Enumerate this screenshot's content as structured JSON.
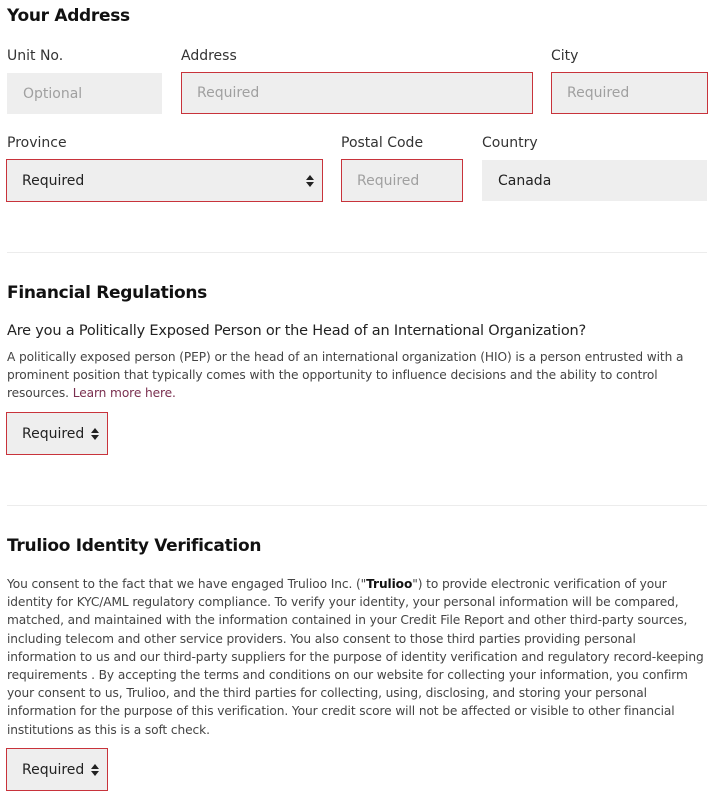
{
  "address_section": {
    "title": "Your Address",
    "unit": {
      "label": "Unit No.",
      "placeholder": "Optional",
      "value": ""
    },
    "address": {
      "label": "Address",
      "placeholder": "Required",
      "value": ""
    },
    "city": {
      "label": "City",
      "placeholder": "Required",
      "value": ""
    },
    "province": {
      "label": "Province",
      "selected": "Required"
    },
    "postal_code": {
      "label": "Postal Code",
      "placeholder": "Required",
      "value": ""
    },
    "country": {
      "label": "Country",
      "value": "Canada"
    }
  },
  "financial_section": {
    "title": "Financial Regulations",
    "question": "Are you a Politically Exposed Person or the Head of an International Organization?",
    "description": "A politically exposed person (PEP) or the head of an international organization (HIO) is a person entrusted with a prominent position that typically comes with the opportunity to influence decisions and the ability to control resources.",
    "learn_more_link": "Learn more here.",
    "pep_select": {
      "selected": "Required"
    }
  },
  "trulioo_section": {
    "title": "Trulioo Identity Verification",
    "consent_intro": "You consent to the fact that we have engaged Trulioo Inc. (\"",
    "consent_bold": "Trulioo",
    "consent_rest": "\") to provide electronic verification of your identity for KYC/AML regulatory compliance. To verify your identity, your personal information will be compared, matched, and maintained with the information contained in your Credit File Report and other third-party sources, including telecom and other service providers. You also consent to those third parties providing personal information to us and our third-party suppliers for the purpose of identity verification and regulatory record-keeping requirements . By accepting the terms and conditions on our website for collecting your information, you confirm your consent to us, Trulioo, and the third parties for collecting, using, disclosing, and storing your personal information for the purpose of this verification. Your credit score will not be affected or visible to other financial institutions as this is a soft check.",
    "consent_select": {
      "selected": "Required"
    }
  },
  "colors": {
    "error_border": "#c8333b",
    "input_background": "#eeeeee",
    "link": "#7a2f4f",
    "divider": "#ececec"
  }
}
